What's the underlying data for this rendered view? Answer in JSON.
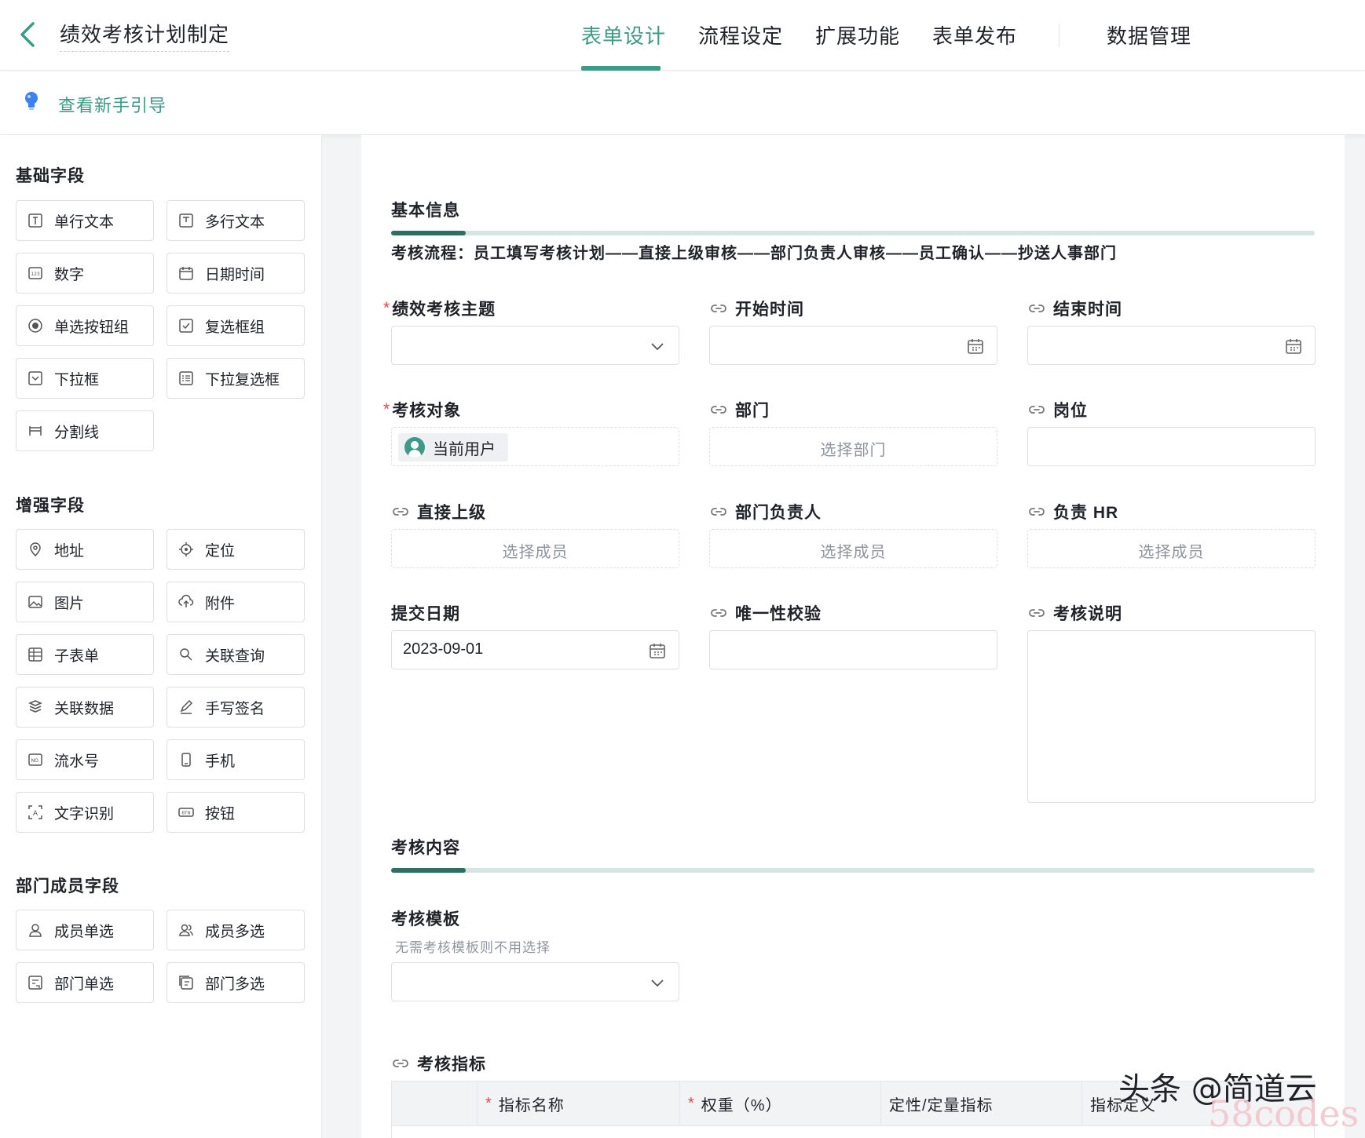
{
  "header": {
    "title": "绩效考核计划制定",
    "tabs": [
      {
        "label": "表单设计",
        "active": true
      },
      {
        "label": "流程设定",
        "active": false
      },
      {
        "label": "扩展功能",
        "active": false
      },
      {
        "label": "表单发布",
        "active": false
      },
      {
        "label": "数据管理",
        "active": false
      }
    ],
    "accent_color": "#3d9a86"
  },
  "guide": {
    "label": "查看新手引导"
  },
  "sidebar": {
    "groups": [
      {
        "title": "基础字段",
        "items": [
          "单行文本",
          "多行文本",
          "数字",
          "日期时间",
          "单选按钮组",
          "复选框组",
          "下拉框",
          "下拉复选框",
          "分割线"
        ]
      },
      {
        "title": "增强字段",
        "items": [
          "地址",
          "定位",
          "图片",
          "附件",
          "子表单",
          "关联查询",
          "关联数据",
          "手写签名",
          "流水号",
          "手机",
          "文字识别",
          "按钮"
        ]
      },
      {
        "title": "部门成员字段",
        "items": [
          "成员单选",
          "成员多选",
          "部门单选",
          "部门多选"
        ]
      }
    ]
  },
  "form": {
    "section1": {
      "title": "基本信息",
      "flow": "考核流程：员工填写考核计划——直接上级审核——部门负责人审核——员工确认——抄送人事部门"
    },
    "fields": {
      "theme": {
        "label": "绩效考核主题",
        "required_mark": "*"
      },
      "start": {
        "label": "开始时间"
      },
      "end": {
        "label": "结束时间"
      },
      "target": {
        "label": "考核对象",
        "required_mark": "*",
        "value": "当前用户"
      },
      "dept": {
        "label": "部门",
        "placeholder": "选择部门"
      },
      "post": {
        "label": "岗位"
      },
      "superior": {
        "label": "直接上级",
        "placeholder": "选择成员"
      },
      "dept_head": {
        "label": "部门负责人",
        "placeholder": "选择成员"
      },
      "hr": {
        "label": "负责 HR",
        "placeholder": "选择成员"
      },
      "submit_date": {
        "label": "提交日期",
        "value": "2023-09-01"
      },
      "unique": {
        "label": "唯一性校验"
      },
      "desc": {
        "label": "考核说明"
      }
    },
    "section2": {
      "title": "考核内容",
      "template_label": "考核模板",
      "template_hint": "无需考核模板则不用选择",
      "indicators_label": "考核指标",
      "table_headers": [
        {
          "label": "指标名称",
          "required_mark": "*"
        },
        {
          "label": "权重（%）",
          "required_mark": "*"
        },
        {
          "label": "定性/定量指标",
          "required_mark": ""
        },
        {
          "label": "指标定义",
          "required_mark": ""
        }
      ]
    }
  },
  "watermark": {
    "text": "头条 @简道云",
    "site": "58codes"
  }
}
